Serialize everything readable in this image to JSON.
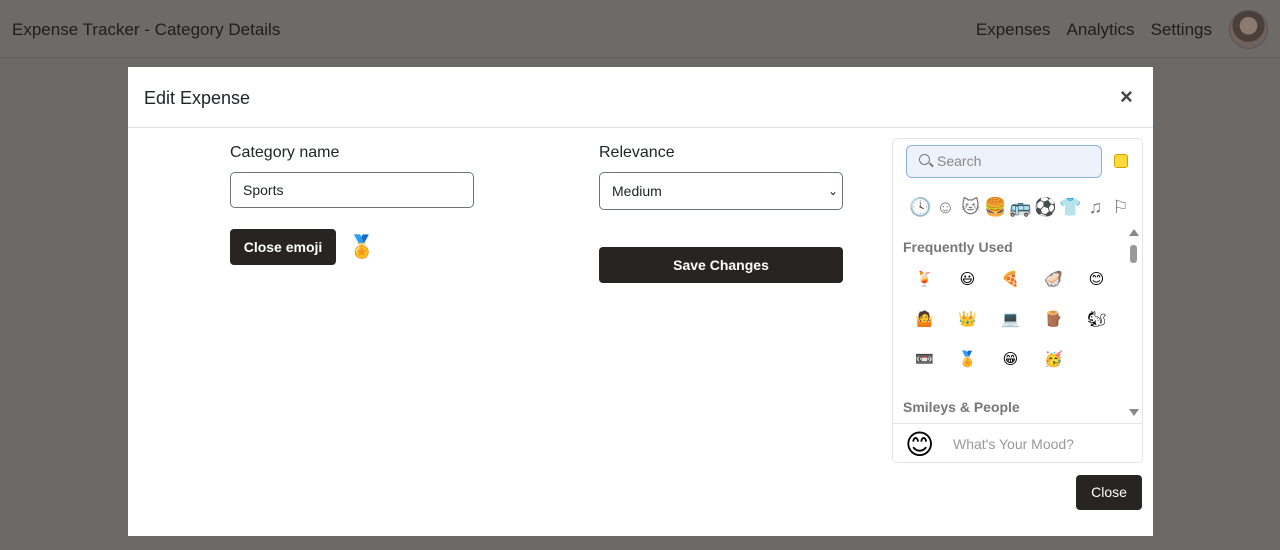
{
  "navbar": {
    "brand": "Expense Tracker - Category Details",
    "links": [
      "Expenses",
      "Analytics",
      "Settings"
    ]
  },
  "modal": {
    "title": "Edit Expense",
    "close_icon": "×",
    "category_label": "Category name",
    "category_value": "Sports",
    "relevance_label": "Relevance",
    "relevance_value": "Medium",
    "close_emoji_button": "Close emoji",
    "selected_emoji": "🏅",
    "save_button": "Save Changes",
    "close_button": "Close"
  },
  "picker": {
    "search_placeholder": "Search",
    "category_icons": [
      "🕓",
      "☺",
      "🐱",
      "🍔",
      "🚌",
      "⚽",
      "👕",
      "♫",
      "⚐"
    ],
    "section_frequent": "Frequently Used",
    "frequent_emojis": [
      "🍹",
      "😃",
      "🍕",
      "🦪",
      "😊",
      "🤷",
      "👑",
      "💻",
      "🪵",
      "🐿",
      "📼",
      "🏅",
      "😁",
      "🥳"
    ],
    "section_smileys": "Smileys & People",
    "mood_emoji": "😊",
    "mood_placeholder": "What's Your Mood?"
  },
  "colors": {
    "backdrop": "#6b6866",
    "dark_button": "#282423",
    "search_border": "#8cb1e4",
    "active_category": "#3f7fd0"
  }
}
